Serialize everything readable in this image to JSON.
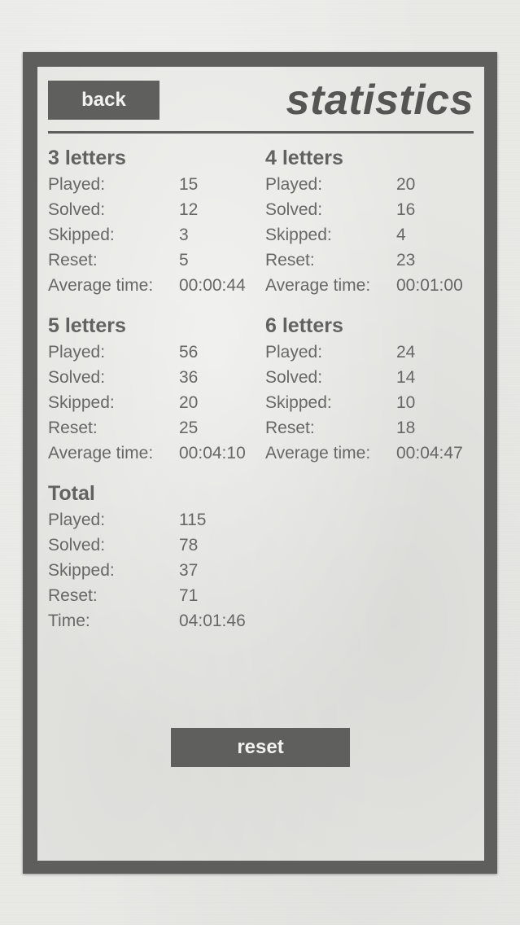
{
  "header": {
    "back_label": "back",
    "title": "statistics"
  },
  "sections": {
    "three": {
      "title": "3 letters",
      "rows": [
        {
          "label": "Played:",
          "value": "15"
        },
        {
          "label": "Solved:",
          "value": "12"
        },
        {
          "label": "Skipped:",
          "value": "3"
        },
        {
          "label": "Reset:",
          "value": "5"
        },
        {
          "label": "Average time:",
          "value": "00:00:44"
        }
      ]
    },
    "four": {
      "title": "4 letters",
      "rows": [
        {
          "label": "Played:",
          "value": "20"
        },
        {
          "label": "Solved:",
          "value": "16"
        },
        {
          "label": "Skipped:",
          "value": "4"
        },
        {
          "label": "Reset:",
          "value": "23"
        },
        {
          "label": "Average time:",
          "value": "00:01:00"
        }
      ]
    },
    "five": {
      "title": "5 letters",
      "rows": [
        {
          "label": "Played:",
          "value": "56"
        },
        {
          "label": "Solved:",
          "value": "36"
        },
        {
          "label": "Skipped:",
          "value": "20"
        },
        {
          "label": "Reset:",
          "value": "25"
        },
        {
          "label": "Average time:",
          "value": "00:04:10"
        }
      ]
    },
    "six": {
      "title": "6 letters",
      "rows": [
        {
          "label": "Played:",
          "value": "24"
        },
        {
          "label": "Solved:",
          "value": "14"
        },
        {
          "label": "Skipped:",
          "value": "10"
        },
        {
          "label": "Reset:",
          "value": "18"
        },
        {
          "label": "Average time:",
          "value": "00:04:47"
        }
      ]
    },
    "total": {
      "title": "Total",
      "rows": [
        {
          "label": "Played:",
          "value": "115"
        },
        {
          "label": "Solved:",
          "value": "78"
        },
        {
          "label": "Skipped:",
          "value": "37"
        },
        {
          "label": "Reset:",
          "value": "71"
        },
        {
          "label": "Time:",
          "value": "04:01:46"
        }
      ]
    }
  },
  "footer": {
    "reset_label": "reset"
  },
  "colors": {
    "frame": "#5e5e5c",
    "panel": "#e6e6e3",
    "button": "#5f5f5d",
    "button_text": "#f2f2f0",
    "text": "#676765"
  }
}
